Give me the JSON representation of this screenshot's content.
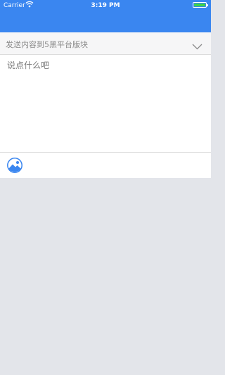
{
  "status_bar": {
    "carrier": "Carrier",
    "time": "3:19 PM",
    "wifi_icon": "wifi-icon",
    "battery_icon": "battery-icon"
  },
  "colors": {
    "header_blue": "#3a86f0",
    "page_background": "#e3e5ea",
    "battery_green": "#3fd34b"
  },
  "section_selector": {
    "label": "发送内容到5黑平台版块",
    "icon": "chevron-down-icon"
  },
  "compose": {
    "placeholder": "说点什么吧"
  },
  "toolbar": {
    "icon": "image-icon"
  }
}
